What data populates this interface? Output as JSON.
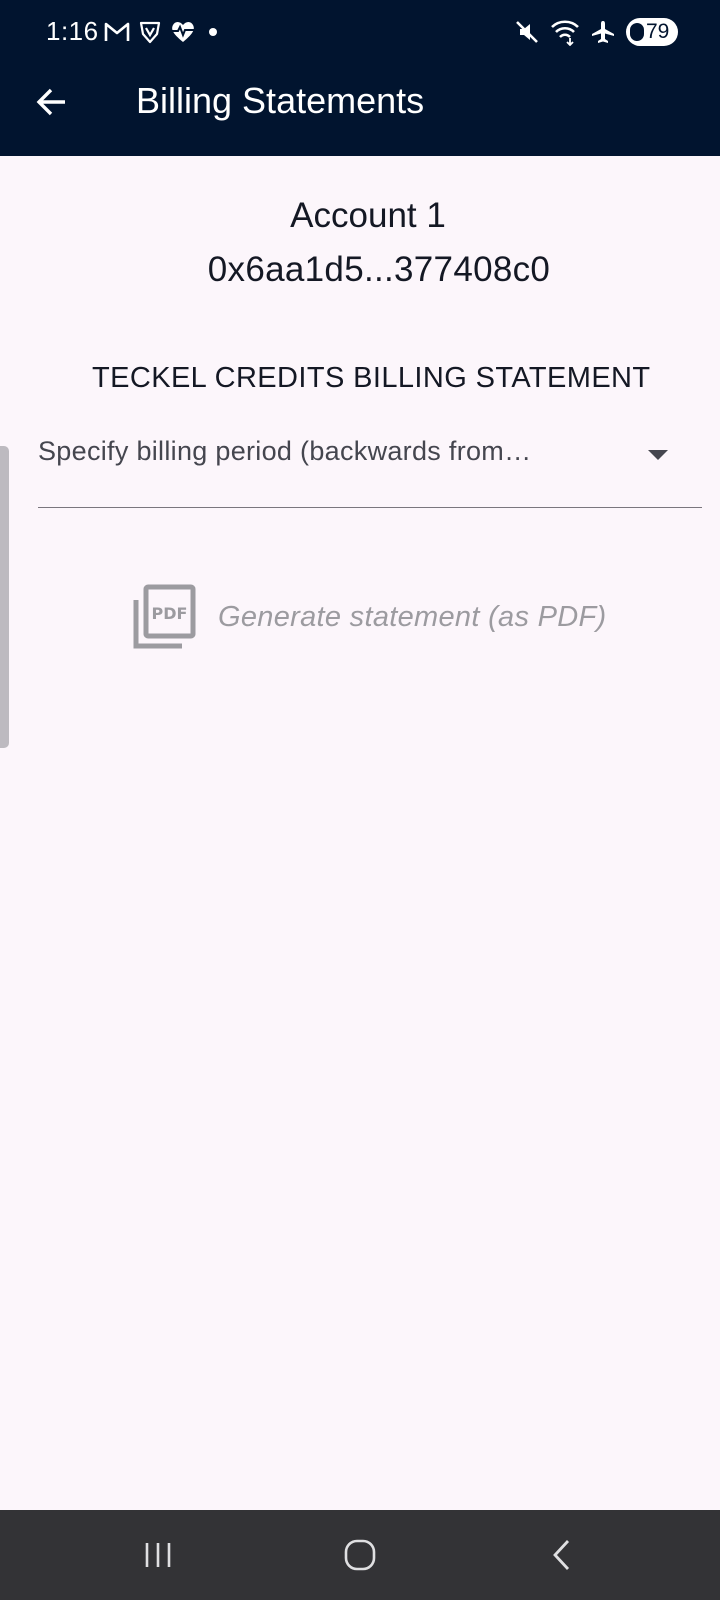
{
  "status_bar": {
    "time": "1:16",
    "left_icons": [
      "gmail-icon",
      "shield-v-icon",
      "heart-pulse-icon",
      "dot-icon"
    ],
    "right_icons": [
      "mute-icon",
      "wifi-icon",
      "airplane-icon"
    ],
    "battery_level": "79"
  },
  "app_bar": {
    "title": "Billing Statements",
    "back_icon": "arrow-back-icon"
  },
  "account": {
    "name": "Account 1",
    "address": "0x6aa1d5...377408c0"
  },
  "statement": {
    "section_title": "TECKEL CREDITS BILLING STATEMENT",
    "period_dropdown_text": "Specify billing period (backwards from…",
    "generate_label": "Generate statement (as PDF)",
    "generate_icon": "picture-as-pdf-icon"
  },
  "nav_bar": {
    "buttons": [
      "recent-apps-icon",
      "home-icon",
      "back-icon"
    ]
  },
  "colors": {
    "app_bar": "#01142f",
    "background": "#fcf6fb",
    "nav_bar": "#333336",
    "disabled_text": "#9c9ba0"
  }
}
